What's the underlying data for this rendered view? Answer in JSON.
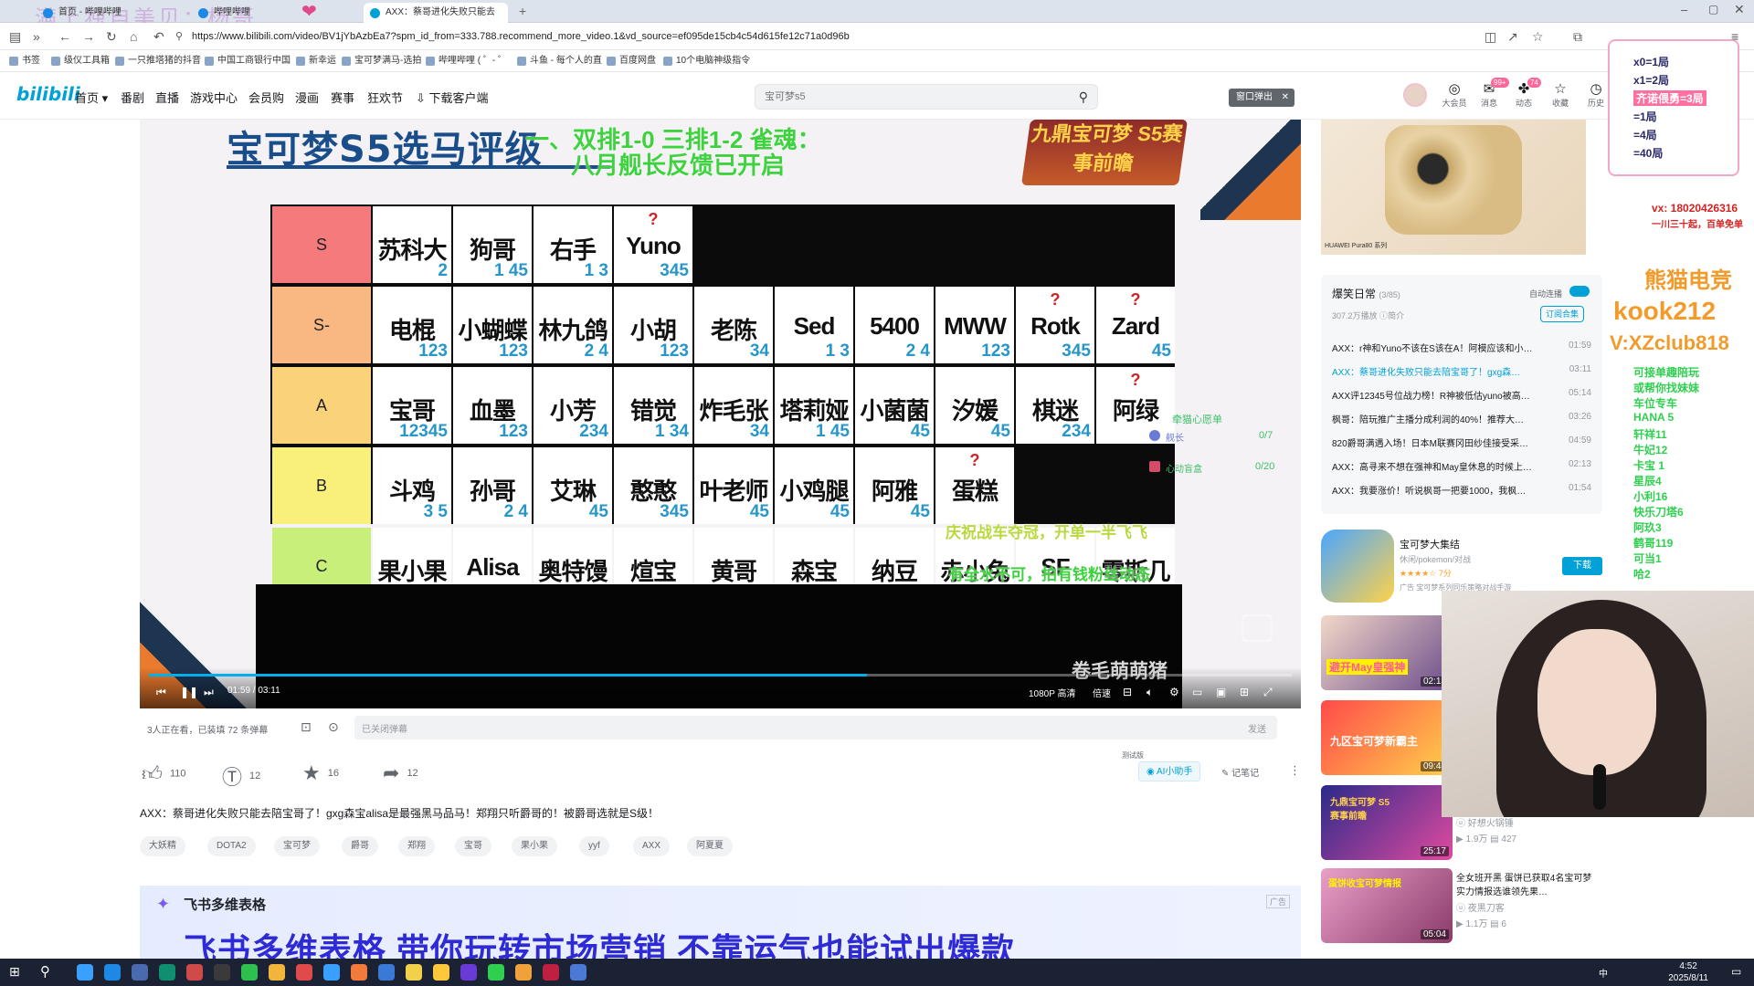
{
  "browser": {
    "watermark": "满上独自美贝：杨哥",
    "tabs": [
      {
        "label": "首页 - 哔哩哔哩"
      },
      {
        "label": "哔哩哔哩"
      },
      {
        "label": "AXX：蔡哥进化失败只能去"
      }
    ],
    "url": "https://www.bilibili.com/video/BV1jYbAzbEa7?spm_id_from=333.788.recommend_more_video.1&vd_source=ef095de15cb4c54d615fe12c71a0d96b",
    "bookmarks": [
      "书签",
      "级仪工具箱",
      "一只推塔猪的抖音",
      "中国工商银行中国",
      "新幸运",
      "宝可梦满马-选拍",
      "哔哩哔哩 ( ゜- ゜",
      "斗鱼 - 每个人的直",
      "百度网盘",
      "10个电脑神级指令"
    ]
  },
  "bili": {
    "logo": "bilibili",
    "nav": [
      "首页",
      "番剧",
      "直播",
      "游戏中心",
      "会员购",
      "漫画",
      "赛事",
      "狂欢节",
      "下载客户端"
    ],
    "search_placeholder": "宝可梦s5",
    "popup_label": "窗口弹出",
    "header_icons": [
      {
        "label": "大会员",
        "glyph": "◎"
      },
      {
        "label": "消息",
        "glyph": "✉",
        "badge": "99+"
      },
      {
        "label": "动态",
        "glyph": "✤",
        "badge": "74"
      },
      {
        "label": "收藏",
        "glyph": "☆"
      },
      {
        "label": "历史",
        "glyph": "◷"
      }
    ]
  },
  "video": {
    "title": "宝可梦S5选马评级",
    "banner": "九鼎宝可梦 S5赛事前瞻",
    "danmaku": [
      {
        "text": "一、双排1-0 三排1-2 雀魂：",
        "color": "#3fd23f"
      },
      {
        "text": "八月舰长反馈已开启",
        "color": "#3fd23f"
      },
      {
        "text": "庆祝战车夺冠，开单一半飞飞",
        "color": "#b9d93f"
      },
      {
        "text": "有全水不可，拍有钱粉丝动态",
        "color": "#3fd23f"
      }
    ],
    "tier_rows": [
      {
        "label": "S",
        "color": "#f47a7c",
        "cells": [
          {
            "name": "苏科大",
            "num": "2",
            "q": ""
          },
          {
            "name": "狗哥",
            "num": "1 45",
            "q": ""
          },
          {
            "name": "右手",
            "num": "1 3",
            "q": ""
          },
          {
            "name": "Yuno",
            "num": "345",
            "q": "?"
          }
        ]
      },
      {
        "label": "S-",
        "color": "#f9b882",
        "cells": [
          {
            "name": "电棍",
            "num": "123",
            "q": ""
          },
          {
            "name": "小蝴蝶",
            "num": "123",
            "q": ""
          },
          {
            "name": "林九鸽",
            "num": "2 4",
            "q": ""
          },
          {
            "name": "小胡",
            "num": "123",
            "q": ""
          },
          {
            "name": "老陈",
            "num": "34",
            "q": ""
          },
          {
            "name": "Sed",
            "num": "1 3",
            "q": ""
          },
          {
            "name": "5400",
            "num": "2 4",
            "q": ""
          },
          {
            "name": "MWW",
            "num": "123",
            "q": ""
          },
          {
            "name": "Rotk",
            "num": "345",
            "q": "?"
          },
          {
            "name": "Zard",
            "num": "45",
            "q": "?"
          }
        ]
      },
      {
        "label": "A",
        "color": "#f9d27a",
        "cells": [
          {
            "name": "宝哥",
            "num": "12345",
            "q": ""
          },
          {
            "name": "血墨",
            "num": "123",
            "q": ""
          },
          {
            "name": "小芳",
            "num": "234",
            "q": ""
          },
          {
            "name": "错觉",
            "num": "1 34",
            "q": ""
          },
          {
            "name": "炸毛张",
            "num": "34",
            "q": ""
          },
          {
            "name": "塔莉娅",
            "num": "1 45",
            "q": ""
          },
          {
            "name": "小菌菌",
            "num": "45",
            "q": ""
          },
          {
            "name": "汐媛",
            "num": "45",
            "q": ""
          },
          {
            "name": "棋迷",
            "num": "234",
            "q": ""
          },
          {
            "name": "阿绿",
            "num": "",
            "q": "?"
          }
        ]
      },
      {
        "label": "B",
        "color": "#f8f07a",
        "cells": [
          {
            "name": "斗鸡",
            "num": "3 5",
            "q": ""
          },
          {
            "name": "孙哥",
            "num": "2 4",
            "q": ""
          },
          {
            "name": "艾琳",
            "num": "45",
            "q": ""
          },
          {
            "name": "憨憨",
            "num": "345",
            "q": ""
          },
          {
            "name": "叶老师",
            "num": "45",
            "q": ""
          },
          {
            "name": "小鸡腿",
            "num": "45",
            "q": ""
          },
          {
            "name": "阿雅",
            "num": "45",
            "q": ""
          },
          {
            "name": "蛋糕",
            "num": "",
            "q": "?"
          }
        ]
      },
      {
        "label": "C",
        "color": "#c8ef7a",
        "cells": [
          {
            "name": "果小果",
            "num": "",
            "q": ""
          },
          {
            "name": "Alisa",
            "num": "",
            "q": ""
          },
          {
            "name": "奥特馒",
            "num": "",
            "q": ""
          },
          {
            "name": "煊宝",
            "num": "",
            "q": ""
          },
          {
            "name": "黄哥",
            "num": "",
            "q": ""
          },
          {
            "name": "森宝",
            "num": "",
            "q": ""
          },
          {
            "name": "纳豆",
            "num": "",
            "q": ""
          },
          {
            "name": "赤小兔",
            "num": "",
            "q": ""
          },
          {
            "name": "SF",
            "num": "",
            "q": ""
          },
          {
            "name": "零斯几",
            "num": "",
            "q": ""
          }
        ]
      }
    ],
    "overlay": {
      "title": "牵猫心愿单",
      "row1_label": "舰长",
      "row1_val": "0/7",
      "row2_label": "心动盲盒",
      "row2_val": "0/20"
    },
    "uploader_watermark": "卷毛萌萌猪",
    "time_current": "01:59",
    "time_total": "03:11",
    "progress": 0.628,
    "quality": "1080P 高清",
    "speed": "倍速"
  },
  "below": {
    "viewers": "3人正在看，已装填 72 条弹幕",
    "danmaku_placeholder": "已关闭弹幕",
    "send": "发送",
    "likes": "110",
    "coins": "12",
    "favs": "16",
    "shares": "12",
    "ai_label": "AI小助手",
    "ai_tag": "测试版",
    "notes_label": "记笔记",
    "description": "AXX：蔡哥进化失败只能去陪宝哥了！gxg森宝alisa是最强黑马品马！郑翔只听爵哥的！被爵哥选就是S级！",
    "tags": [
      "大妖精",
      "DOTA2",
      "宝可梦",
      "爵哥",
      "郑翔",
      "宝哥",
      "果小果",
      "yyf",
      "AXX",
      "阿夏夏"
    ]
  },
  "ad": {
    "brand": "飞书多维表格",
    "slogan": "飞书多维表格 带你玩转市场营销 不靠运气也能试出爆款",
    "tag": "广告"
  },
  "right": {
    "phone_caption": "HUAWEI Pura80 系列",
    "ad_tag": "广告",
    "playlist_title": "爆笑日常",
    "playlist_count": "(3/85)",
    "autoplay": "自动连播",
    "plays": "307.2万播放",
    "intro": "简介",
    "subscribe": "订阅合集",
    "playlist": [
      {
        "title": "AXX：r神和Yuno不该在S该在A！阿模应该和小…",
        "dur": "01:59"
      },
      {
        "title": "AXX：蔡哥进化失败只能去陪宝哥了！gxg森…",
        "dur": "03:11",
        "current": true
      },
      {
        "title": "AXX评12345号位战力榜！R神被低估yuno被高…",
        "dur": "05:14"
      },
      {
        "title": "枫哥：陪玩推广主播分成利润的40%！推荐大…",
        "dur": "03:26"
      },
      {
        "title": "820爵哥满遇入场！日本M联赛冈田纱佳接受采…",
        "dur": "04:59"
      },
      {
        "title": "AXX：高寻来不想在强神和May皇休息的时候上…",
        "dur": "02:13"
      },
      {
        "title": "AXX：我要涨价！听说枫哥一把要1000，我枫…",
        "dur": "01:54"
      }
    ],
    "app": {
      "name": "宝可梦大集结",
      "meta": "休闲/pokemon/对战",
      "rating": "7分",
      "download": "下载",
      "ad": "广告",
      "sub": "宝可梦系列同乐策略对战手游"
    },
    "videos": [
      {
        "dur": "02:13",
        "caption": "避开May皇强神"
      },
      {
        "dur": "09:45",
        "caption": "九区宝可梦新霸主"
      },
      {
        "dur": "25:17",
        "caption": "九鼎宝可梦 S5赛事前瞻",
        "views": "1.9万",
        "danmaku": "427",
        "author": "好想火锅锤"
      },
      {
        "dur": "05:04",
        "caption": "蛋饼收宝可梦情报",
        "title": "全女班开黑 蛋饼已获取4名宝可梦实力情报选谁领先果…",
        "author": "夜黑刀客",
        "views": "1.1万",
        "danmaku": "6"
      }
    ]
  },
  "overlay_right": {
    "lines": [
      {
        "text": "x0=1局",
        "color": "#f2e44a"
      },
      {
        "text": "x1=2局",
        "color": "#f2e44a"
      },
      {
        "text": "齐诺偎勇=3局",
        "color": "#ff6fa1"
      },
      {
        "text": "=1局",
        "color": "#ffffff"
      },
      {
        "text": "=4局",
        "color": "#ffffff"
      },
      {
        "text": "=40局",
        "color": "#ffffff"
      }
    ],
    "qq": "vx: 18020426316",
    "qq_sub": "一川三十起，百单免单",
    "brand": "熊猫电竞",
    "kook": "kook212",
    "vx": "V:XZclub818",
    "gifts": [
      "可接单趣陪玩",
      "或帮你找妹妹",
      "车位专车",
      "HANA 5",
      "轩祥11",
      "牛妃12",
      "卡宝 1",
      "星辰4",
      "小利16",
      "快乐刀塔6",
      "阿玖3",
      "鹤哥119",
      "可当1",
      "哈2"
    ]
  },
  "taskbar": {
    "time": "4:52",
    "date": "2025/8/11",
    "ime": "中"
  }
}
